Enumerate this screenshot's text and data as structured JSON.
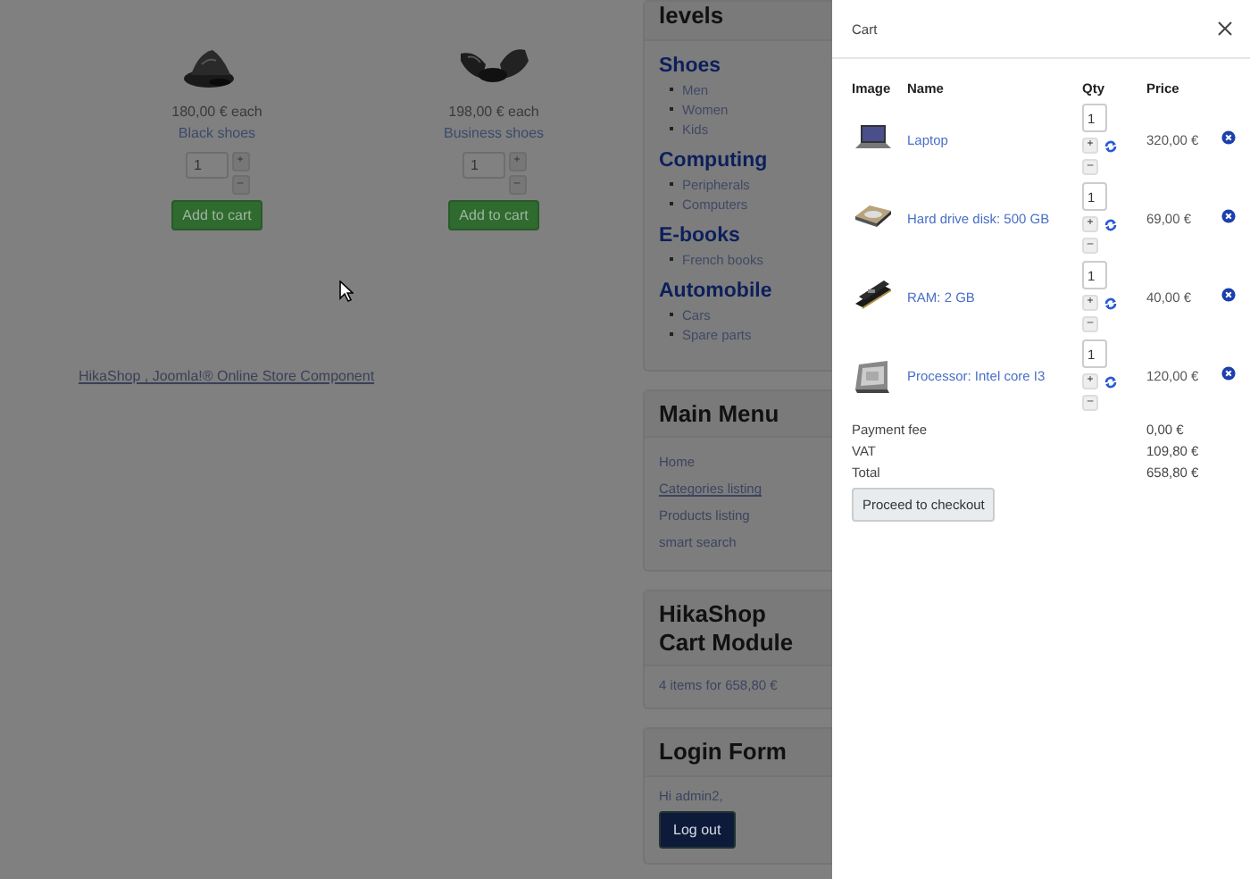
{
  "products": [
    {
      "price": "180,00 € each",
      "name": "Black shoes",
      "quantity": "1",
      "plus": "+",
      "minus": "–",
      "button": "Add to cart"
    },
    {
      "price": "198,00 € each",
      "name": "Business shoes",
      "quantity": "1",
      "plus": "+",
      "minus": "–",
      "button": "Add to cart"
    }
  ],
  "footer_link": "HikaShop , Joomla!® Online Store Component",
  "sidebar": {
    "categories_module": {
      "title": "levels",
      "groups": [
        {
          "title": "Shoes",
          "items": [
            "Men",
            "Women",
            "Kids"
          ]
        },
        {
          "title": "Computing",
          "items": [
            "Peripherals",
            "Computers"
          ]
        },
        {
          "title": "E-books",
          "items": [
            "French books"
          ]
        },
        {
          "title": "Automobile",
          "items": [
            "Cars",
            "Spare parts"
          ]
        }
      ]
    },
    "main_menu": {
      "title": "Main Menu",
      "items": [
        {
          "label": "Home",
          "hovered": false
        },
        {
          "label": "Categories listing",
          "hovered": true
        },
        {
          "label": "Products listing",
          "hovered": false
        },
        {
          "label": "smart search",
          "hovered": false
        }
      ]
    },
    "cart_module": {
      "title": "HikaShop Cart Module",
      "summary": "4 items for 658,80 €"
    },
    "login_module": {
      "title": "Login Form",
      "greeting": "Hi admin2,",
      "button": "Log out"
    }
  },
  "cart": {
    "title": "Cart",
    "columns": [
      "Image",
      "Name",
      "Qty",
      "Price"
    ],
    "rows": [
      {
        "kind": "laptop",
        "name": "Laptop",
        "quantity": "1",
        "plus": "+",
        "minus": "–",
        "price": "320,00 €"
      },
      {
        "kind": "disk",
        "name": "Hard drive disk: 500 GB",
        "quantity": "1",
        "plus": "+",
        "minus": "–",
        "price": "69,00 €"
      },
      {
        "kind": "ram",
        "name": "RAM: 2 GB",
        "quantity": "1",
        "plus": "+",
        "minus": "–",
        "price": "40,00 €"
      },
      {
        "kind": "cpu",
        "name": "Processor: Intel core I3",
        "quantity": "1",
        "plus": "+",
        "minus": "–",
        "price": "120,00 €"
      }
    ],
    "totals": [
      {
        "label": "Payment fee",
        "value": "0,00 €"
      },
      {
        "label": "VAT",
        "value": "109,80 €"
      },
      {
        "label": "Total",
        "value": "658,80 €"
      }
    ],
    "button": "Proceed to checkout"
  }
}
